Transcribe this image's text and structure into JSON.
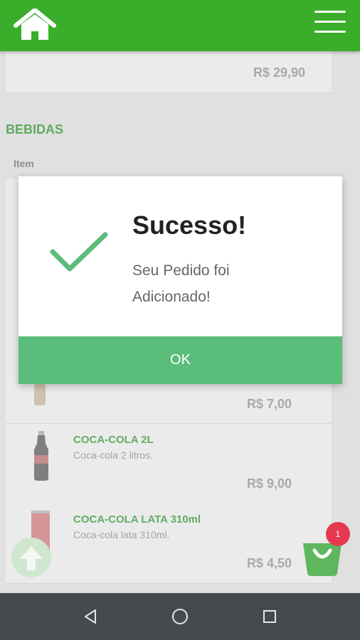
{
  "header": {
    "home_icon": "home-icon",
    "menu_icon": "hamburger-menu-icon"
  },
  "products_above": {
    "price": "R$ 29,90"
  },
  "section": {
    "title": "BEBIDAS",
    "column_item": "Item"
  },
  "products": [
    {
      "price": "R$ 7,00"
    },
    {
      "name": "COCA-COLA 2L",
      "desc": "Coca-cola 2 litros.",
      "price": "R$ 9,00"
    },
    {
      "name": "COCA-COLA LATA 310ml",
      "desc": "Coca-cola lata 310ml.",
      "price": "R$ 4,50"
    }
  ],
  "dialog": {
    "title": "Sucesso!",
    "message": "Seu Pedido foi Adicionado!",
    "ok_label": "OK",
    "icon": "checkmark-icon"
  },
  "cart": {
    "badge_count": "1",
    "icon": "shopping-bag-icon"
  },
  "scroll_top_icon": "arrow-up-icon",
  "nav": {
    "back_icon": "back-icon",
    "home_icon": "home-circle-icon",
    "recents_icon": "recents-icon"
  },
  "colors": {
    "primary": "#3aad2b",
    "accent": "#5bbd7a",
    "badge": "#e53950",
    "navbar": "#454a4f"
  }
}
